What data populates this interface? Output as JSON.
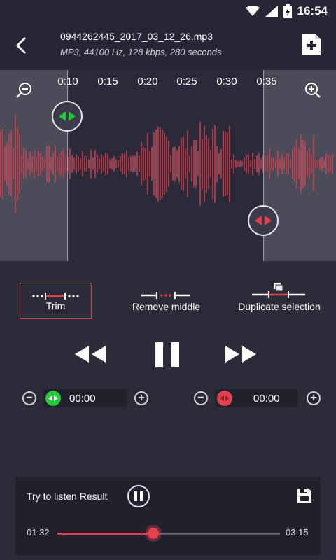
{
  "status_bar": {
    "time": "16:54"
  },
  "header": {
    "file_name": "0944262445_2017_03_12_26.mp3",
    "file_info": "MP3, 44100 Hz, 128 kbps, 280 seconds"
  },
  "timeline": {
    "labels": [
      "0:10",
      "0:15",
      "0:20",
      "0:25",
      "0:30",
      "0:35"
    ]
  },
  "tools": {
    "trim": "Trim",
    "remove_middle": "Remove middle",
    "duplicate_selection": "Duplicate selection",
    "active": "Trim"
  },
  "start_control": {
    "time": "00:00"
  },
  "end_control": {
    "time": "00:00"
  },
  "result": {
    "title": "Try to listen Result",
    "current_time": "01:32",
    "total_time": "03:15",
    "progress": 0.43
  },
  "colors": {
    "accent": "#e3414d",
    "start_handle": "#28c83c",
    "end_handle": "#e3414d",
    "waveform": "#d8434f"
  }
}
